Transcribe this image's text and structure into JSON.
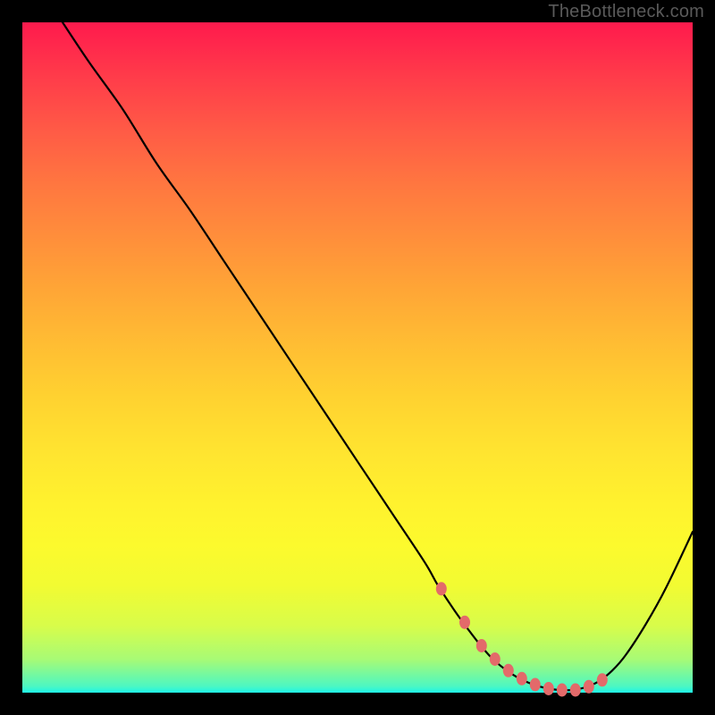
{
  "watermark": "TheBottleneck.com",
  "colors": {
    "curve": "#000000",
    "marker": "#e36a6a",
    "frame": "#000000"
  },
  "chart_data": {
    "type": "line",
    "title": "",
    "xlabel": "",
    "ylabel": "",
    "xlim": [
      0,
      100
    ],
    "ylim": [
      0,
      100
    ],
    "grid": false,
    "legend": false,
    "series": [
      {
        "name": "curve",
        "x": [
          6,
          10,
          15,
          20,
          25,
          30,
          35,
          40,
          45,
          50,
          55,
          60,
          62,
          65,
          68,
          70,
          72,
          74,
          76,
          78,
          80,
          82,
          84,
          86,
          88,
          90,
          93,
          96,
          100
        ],
        "y": [
          100,
          94,
          87,
          79,
          72,
          64.5,
          57,
          49.5,
          42,
          34.5,
          27,
          19.5,
          16,
          11.5,
          7.5,
          5.2,
          3.5,
          2.2,
          1.3,
          0.7,
          0.4,
          0.4,
          0.8,
          1.7,
          3.3,
          5.6,
          10.2,
          15.6,
          24
        ]
      }
    ],
    "markers": {
      "name": "flat-bottom-markers",
      "x": [
        62.5,
        66,
        68.5,
        70.5,
        72.5,
        74.5,
        76.5,
        78.5,
        80.5,
        82.5,
        84.5,
        86.5
      ],
      "y": [
        15.5,
        10.5,
        7.0,
        5.0,
        3.3,
        2.1,
        1.2,
        0.6,
        0.4,
        0.4,
        0.9,
        1.9
      ]
    }
  }
}
